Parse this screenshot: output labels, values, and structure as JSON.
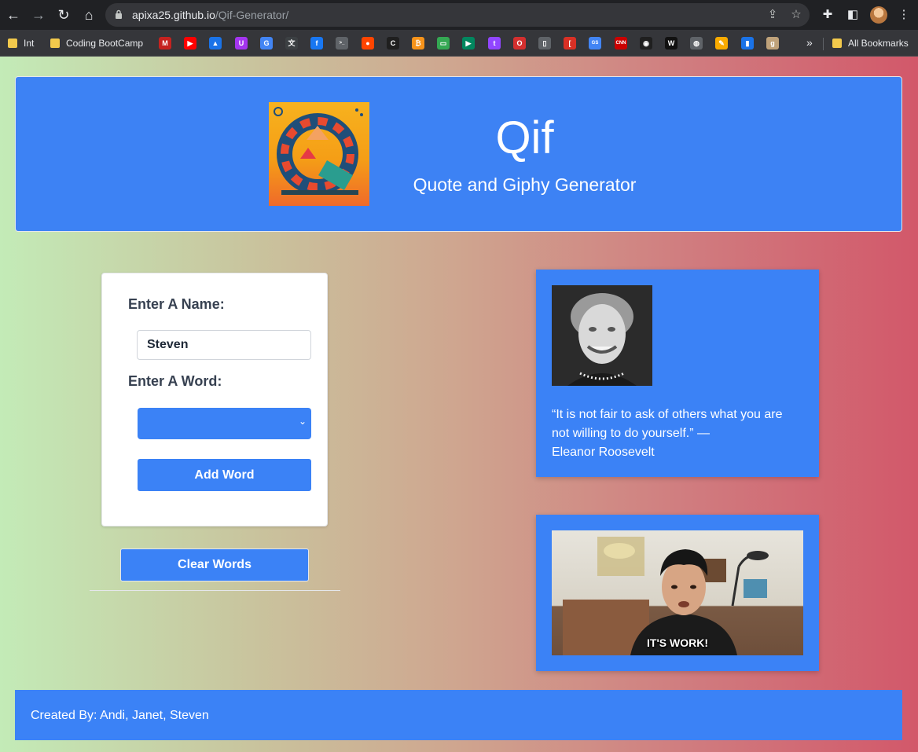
{
  "browser": {
    "url_host": "apixa25.github.io",
    "url_path": "/Qif-Generator/",
    "bookmarks": {
      "folders": [
        "Int",
        "Coding BootCamp"
      ],
      "all_label": "All Bookmarks",
      "favicons": [
        {
          "icon": "gmail-icon",
          "glyph": "M",
          "color": "#c5221f"
        },
        {
          "icon": "youtube-icon",
          "glyph": "▶",
          "color": "#ff0000"
        },
        {
          "icon": "google-drive-icon",
          "glyph": "▲",
          "color": "#1a73e8"
        },
        {
          "icon": "udemy-icon",
          "glyph": "U",
          "color": "#a435f0"
        },
        {
          "icon": "google-icon",
          "glyph": "G",
          "color": "#4285f4"
        },
        {
          "icon": "translate-icon",
          "glyph": "文",
          "color": "#3c4043"
        },
        {
          "icon": "facebook-icon",
          "glyph": "f",
          "color": "#1877f2"
        },
        {
          "icon": "terminal-icon",
          "glyph": ">_",
          "color": "#5f6368"
        },
        {
          "icon": "reddit-icon",
          "glyph": "●",
          "color": "#ff4500"
        },
        {
          "icon": "circle-c-icon",
          "glyph": "C",
          "color": "#1f1f1f"
        },
        {
          "icon": "bitcoin-icon",
          "glyph": "₿",
          "color": "#f7931a"
        },
        {
          "icon": "monitor-icon",
          "glyph": "▭",
          "color": "#34a853"
        },
        {
          "icon": "google-play-icon",
          "glyph": "▶",
          "color": "#01875f"
        },
        {
          "icon": "twitch-icon",
          "glyph": "t",
          "color": "#9146ff"
        },
        {
          "icon": "opera-icon",
          "glyph": "O",
          "color": "#d32f2f"
        },
        {
          "icon": "document-icon",
          "glyph": "▯",
          "color": "#5f6368"
        },
        {
          "icon": "bracket-icon",
          "glyph": "[",
          "color": "#d93025"
        },
        {
          "icon": "gs-icon",
          "glyph": "GS",
          "color": "#4285f4"
        },
        {
          "icon": "cnn-icon",
          "glyph": "CNN",
          "color": "#cc0000"
        },
        {
          "icon": "globe-ring-icon",
          "glyph": "◉",
          "color": "#1f1f1f"
        },
        {
          "icon": "w-icon",
          "glyph": "W",
          "color": "#111111"
        },
        {
          "icon": "world-icon",
          "glyph": "◍",
          "color": "#5f6368"
        },
        {
          "icon": "pencil-icon",
          "glyph": "✎",
          "color": "#f9ab00"
        },
        {
          "icon": "bars-icon",
          "glyph": "▮",
          "color": "#1a73e8"
        },
        {
          "icon": "g-box-icon",
          "glyph": "g",
          "color": "#bfa27a"
        }
      ]
    }
  },
  "header": {
    "title": "Qif",
    "subtitle": "Quote and Giphy Generator"
  },
  "form": {
    "name_label": "Enter A Name:",
    "name_value": "Steven",
    "word_label": "Enter A Word:",
    "word_selected": "",
    "add_button": "Add Word",
    "clear_button": "Clear Words"
  },
  "quote": {
    "text": "“It is not fair to ask of others what you are not willing to do yourself.” —",
    "author": "Eleanor Roosevelt"
  },
  "gif": {
    "caption": "IT'S WORK!"
  },
  "footer": {
    "credits": "Created By: Andi, Janet, Steven"
  },
  "colors": {
    "accent": "#3b82f6",
    "gradient_start": "#c3ebb7",
    "gradient_end": "#d2586a"
  }
}
